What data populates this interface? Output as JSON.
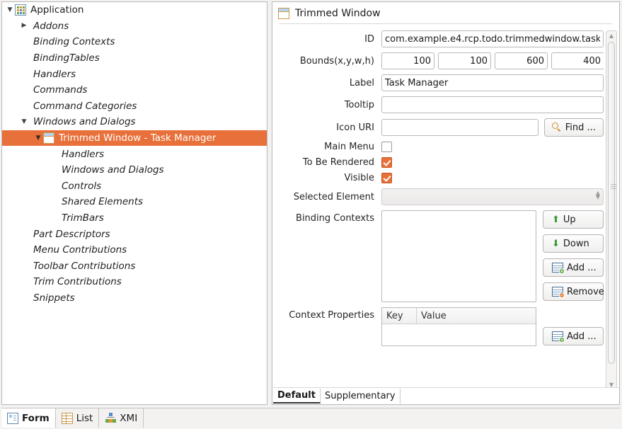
{
  "tree": {
    "rows": [
      {
        "label": "Application",
        "indent": 0,
        "twisty": "expanded",
        "icon": "application-grid-icon",
        "italic": false,
        "selected": false
      },
      {
        "label": "Addons",
        "indent": 1,
        "twisty": "collapsed",
        "icon": "none",
        "italic": true,
        "selected": false
      },
      {
        "label": "Binding Contexts",
        "indent": 1,
        "twisty": "none",
        "icon": "none",
        "italic": true,
        "selected": false
      },
      {
        "label": "BindingTables",
        "indent": 1,
        "twisty": "none",
        "icon": "none",
        "italic": true,
        "selected": false
      },
      {
        "label": "Handlers",
        "indent": 1,
        "twisty": "none",
        "icon": "none",
        "italic": true,
        "selected": false
      },
      {
        "label": "Commands",
        "indent": 1,
        "twisty": "none",
        "icon": "none",
        "italic": true,
        "selected": false
      },
      {
        "label": "Command Categories",
        "indent": 1,
        "twisty": "none",
        "icon": "none",
        "italic": true,
        "selected": false
      },
      {
        "label": "Windows and Dialogs",
        "indent": 1,
        "twisty": "expanded",
        "icon": "none",
        "italic": true,
        "selected": false
      },
      {
        "label": "Trimmed Window - Task Manager",
        "indent": 2,
        "twisty": "expanded",
        "icon": "trimmed-window-icon",
        "italic": false,
        "selected": true
      },
      {
        "label": "Handlers",
        "indent": 3,
        "twisty": "none",
        "icon": "none",
        "italic": true,
        "selected": false
      },
      {
        "label": "Windows and Dialogs",
        "indent": 3,
        "twisty": "none",
        "icon": "none",
        "italic": true,
        "selected": false
      },
      {
        "label": "Controls",
        "indent": 3,
        "twisty": "none",
        "icon": "none",
        "italic": true,
        "selected": false
      },
      {
        "label": "Shared Elements",
        "indent": 3,
        "twisty": "none",
        "icon": "none",
        "italic": true,
        "selected": false
      },
      {
        "label": "TrimBars",
        "indent": 3,
        "twisty": "none",
        "icon": "none",
        "italic": true,
        "selected": false
      },
      {
        "label": "Part Descriptors",
        "indent": 1,
        "twisty": "none",
        "icon": "none",
        "italic": true,
        "selected": false
      },
      {
        "label": "Menu Contributions",
        "indent": 1,
        "twisty": "none",
        "icon": "none",
        "italic": true,
        "selected": false
      },
      {
        "label": "Toolbar Contributions",
        "indent": 1,
        "twisty": "none",
        "icon": "none",
        "italic": true,
        "selected": false
      },
      {
        "label": "Trim Contributions",
        "indent": 1,
        "twisty": "none",
        "icon": "none",
        "italic": true,
        "selected": false
      },
      {
        "label": "Snippets",
        "indent": 1,
        "twisty": "none",
        "icon": "none",
        "italic": true,
        "selected": false
      }
    ]
  },
  "form": {
    "title": "Trimmed Window",
    "fields": {
      "id_label": "ID",
      "id_value": "com.example.e4.rcp.todo.trimmedwindow.task",
      "bounds_label": "Bounds(x,y,w,h)",
      "bounds_x": "100",
      "bounds_y": "100",
      "bounds_w": "600",
      "bounds_h": "400",
      "label_label": "Label",
      "label_value": "Task Manager",
      "tooltip_label": "Tooltip",
      "tooltip_value": "",
      "icon_uri_label": "Icon URI",
      "icon_uri_value": "",
      "find_button": "Find ...",
      "main_menu_label": "Main Menu",
      "main_menu_checked": false,
      "to_be_rendered_label": "To Be Rendered",
      "to_be_rendered_checked": true,
      "visible_label": "Visible",
      "visible_checked": true,
      "selected_element_label": "Selected Element",
      "selected_element_value": "",
      "binding_contexts_label": "Binding Contexts",
      "context_properties_label": "Context Properties"
    },
    "binding_buttons": {
      "up": "Up",
      "down": "Down",
      "add": "Add ...",
      "remove": "Remove"
    },
    "context_table": {
      "columns": [
        "Key",
        "Value"
      ],
      "rows": [],
      "add_button": "Add ..."
    },
    "inner_tabs": [
      {
        "label": "Default",
        "active": true
      },
      {
        "label": "Supplementary",
        "active": false
      }
    ]
  },
  "bottom_tabs": [
    {
      "label": "Form",
      "icon": "form-icon",
      "active": true
    },
    {
      "label": "List",
      "icon": "list-icon",
      "active": false
    },
    {
      "label": "XMI",
      "icon": "xmi-icon",
      "active": false
    }
  ],
  "colors": {
    "selection": "#e8703a",
    "checkbox_on": "#e8703a",
    "panel_bg": "#ffffff",
    "window_bg": "#f3f2f1"
  }
}
